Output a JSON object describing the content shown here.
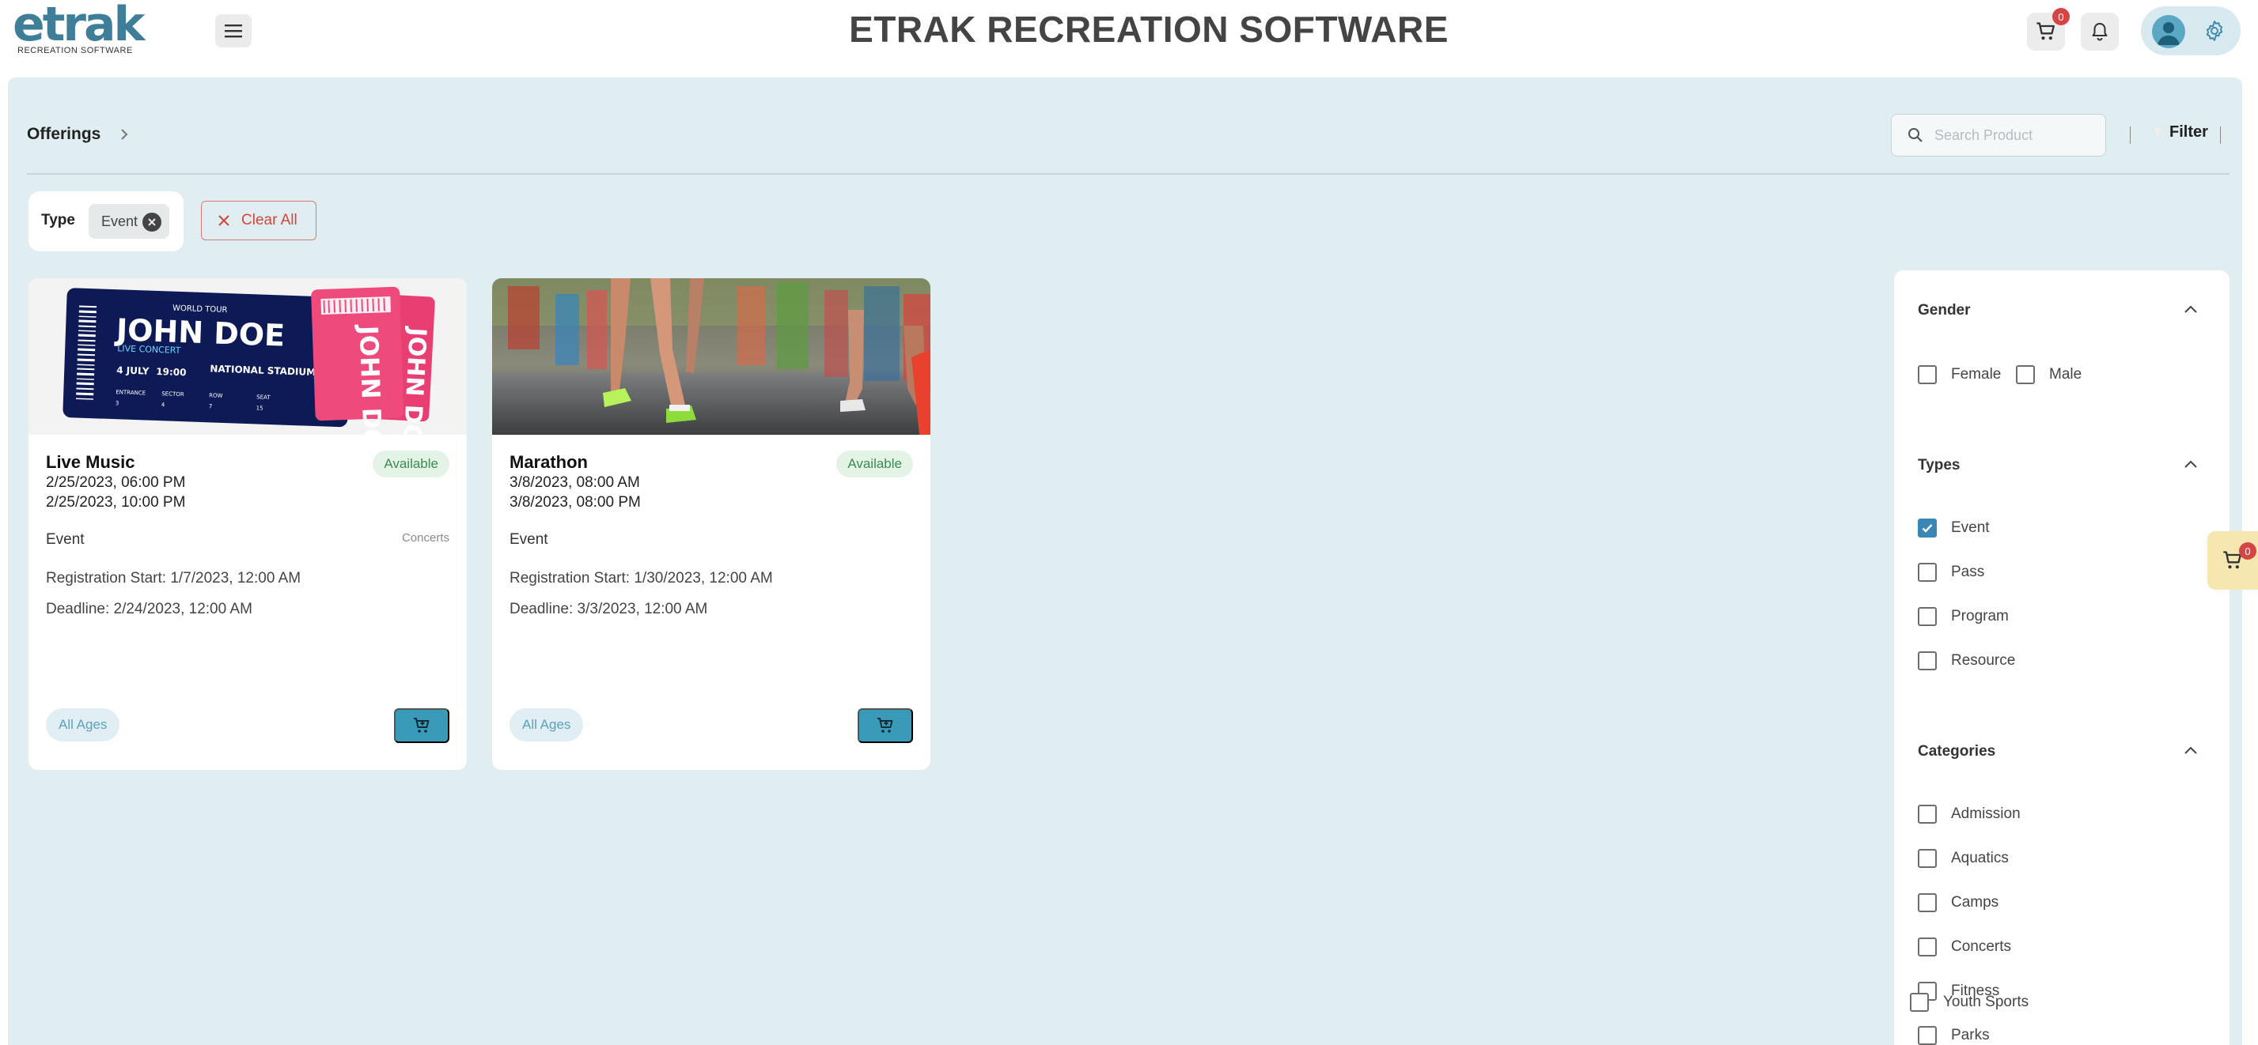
{
  "header": {
    "logo_text": "etrak",
    "logo_subtext": "RECREATION SOFTWARE",
    "title": "ETRAK RECREATION SOFTWARE",
    "cart_count": "0",
    "icons": [
      "menu-icon",
      "cart-icon",
      "bell-icon",
      "user-icon",
      "gear-icon"
    ]
  },
  "toolbar": {
    "breadcrumb": "Offerings",
    "search_placeholder": "Search Product",
    "filter_label": "Filter"
  },
  "active_filters": {
    "group_label": "Type",
    "chips": [
      {
        "label": "Event"
      }
    ],
    "clear_label": "Clear All"
  },
  "products": [
    {
      "name": "Live Music",
      "start": "2/25/2023, 06:00 PM",
      "end": "2/25/2023, 10:00 PM",
      "status": "Available",
      "type": "Event",
      "category": "Concerts",
      "registration": "Registration Start: 1/7/2023, 12:00 AM",
      "deadline": "Deadline: 2/24/2023, 12:00 AM",
      "age": "All Ages",
      "image": {
        "kind": "concert-ticket",
        "ticket_name": "JOHN DOE",
        "ticket_top": "WORLD TOUR",
        "ticket_sub": "LIVE CONCERT",
        "ticket_date": "4 JULY",
        "ticket_time": "19:00",
        "ticket_venue": "NATIONAL STADIUM",
        "ticket_fields": [
          "ENTRANCE",
          "SECTOR",
          "ROW",
          "SEAT"
        ],
        "ticket_values": [
          "3",
          "4",
          "7",
          "15"
        ]
      }
    },
    {
      "name": "Marathon",
      "start": "3/8/2023, 08:00 AM",
      "end": "3/8/2023, 08:00 PM",
      "status": "Available",
      "type": "Event",
      "category": "",
      "registration": "Registration Start: 1/30/2023, 12:00 AM",
      "deadline": "Deadline: 3/3/2023, 12:00 AM",
      "age": "All Ages",
      "image": {
        "kind": "runners-photo"
      }
    }
  ],
  "filter_panel": {
    "sections": [
      {
        "title": "Gender",
        "options": [
          {
            "label": "Female",
            "checked": false
          },
          {
            "label": "Male",
            "checked": false
          }
        ]
      },
      {
        "title": "Types",
        "options": [
          {
            "label": "Event",
            "checked": true
          },
          {
            "label": "Pass",
            "checked": false
          },
          {
            "label": "Program",
            "checked": false
          },
          {
            "label": "Resource",
            "checked": false
          }
        ]
      },
      {
        "title": "Categories",
        "options": [
          {
            "label": "Admission",
            "checked": false
          },
          {
            "label": "Aquatics",
            "checked": false
          },
          {
            "label": "Camps",
            "checked": false
          },
          {
            "label": "Concerts",
            "checked": false
          },
          {
            "label": "Fitness",
            "checked": false
          },
          {
            "label": "Parks",
            "checked": false
          },
          {
            "label": "Youth Sports",
            "checked": false
          }
        ]
      }
    ]
  },
  "floating_cart": {
    "count": "0"
  },
  "colors": {
    "brand": "#3f7e98",
    "accent": "#3a9bb8",
    "background": "#e0edf1",
    "badge_bg": "#e3f4e7",
    "badge_text": "#3b8b4f",
    "danger": "#d2463c"
  }
}
